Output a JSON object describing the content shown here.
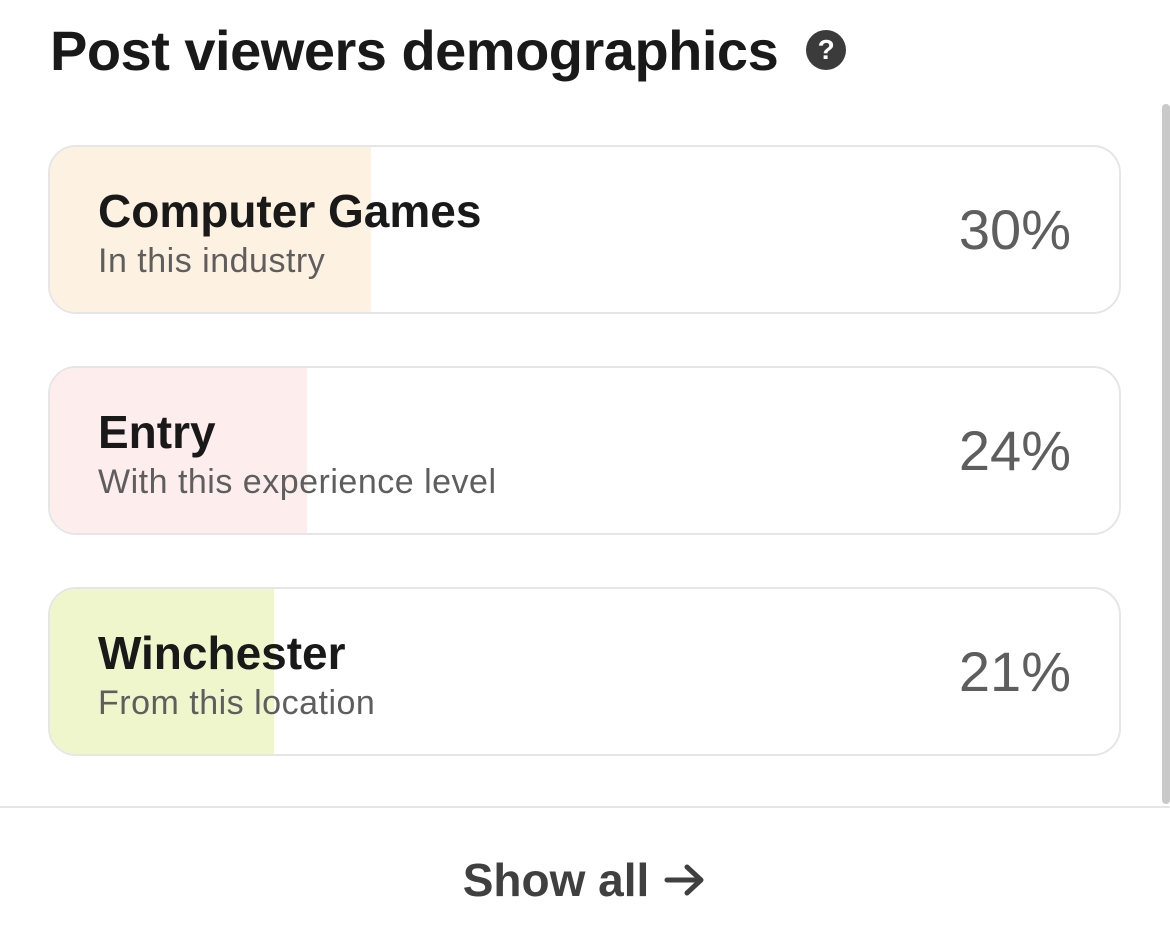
{
  "header": {
    "title": "Post viewers demographics",
    "help_icon": "?"
  },
  "cards": [
    {
      "title": "Computer Games",
      "subtitle": "In this industry",
      "percent_label": "30%",
      "percent": 30,
      "fill_color": "#fdf1e1",
      "fill_border": "#f2dcc0"
    },
    {
      "title": "Entry",
      "subtitle": "With this experience level",
      "percent_label": "24%",
      "percent": 24,
      "fill_color": "#fdeeed",
      "fill_border": "#f1d6d4"
    },
    {
      "title": "Winchester",
      "subtitle": "From this location",
      "percent_label": "21%",
      "percent": 21,
      "fill_color": "#f0f6cc",
      "fill_border": "#dbe5b0"
    }
  ],
  "footer": {
    "show_all_label": "Show all",
    "arrow_icon": "arrow-right-icon"
  }
}
